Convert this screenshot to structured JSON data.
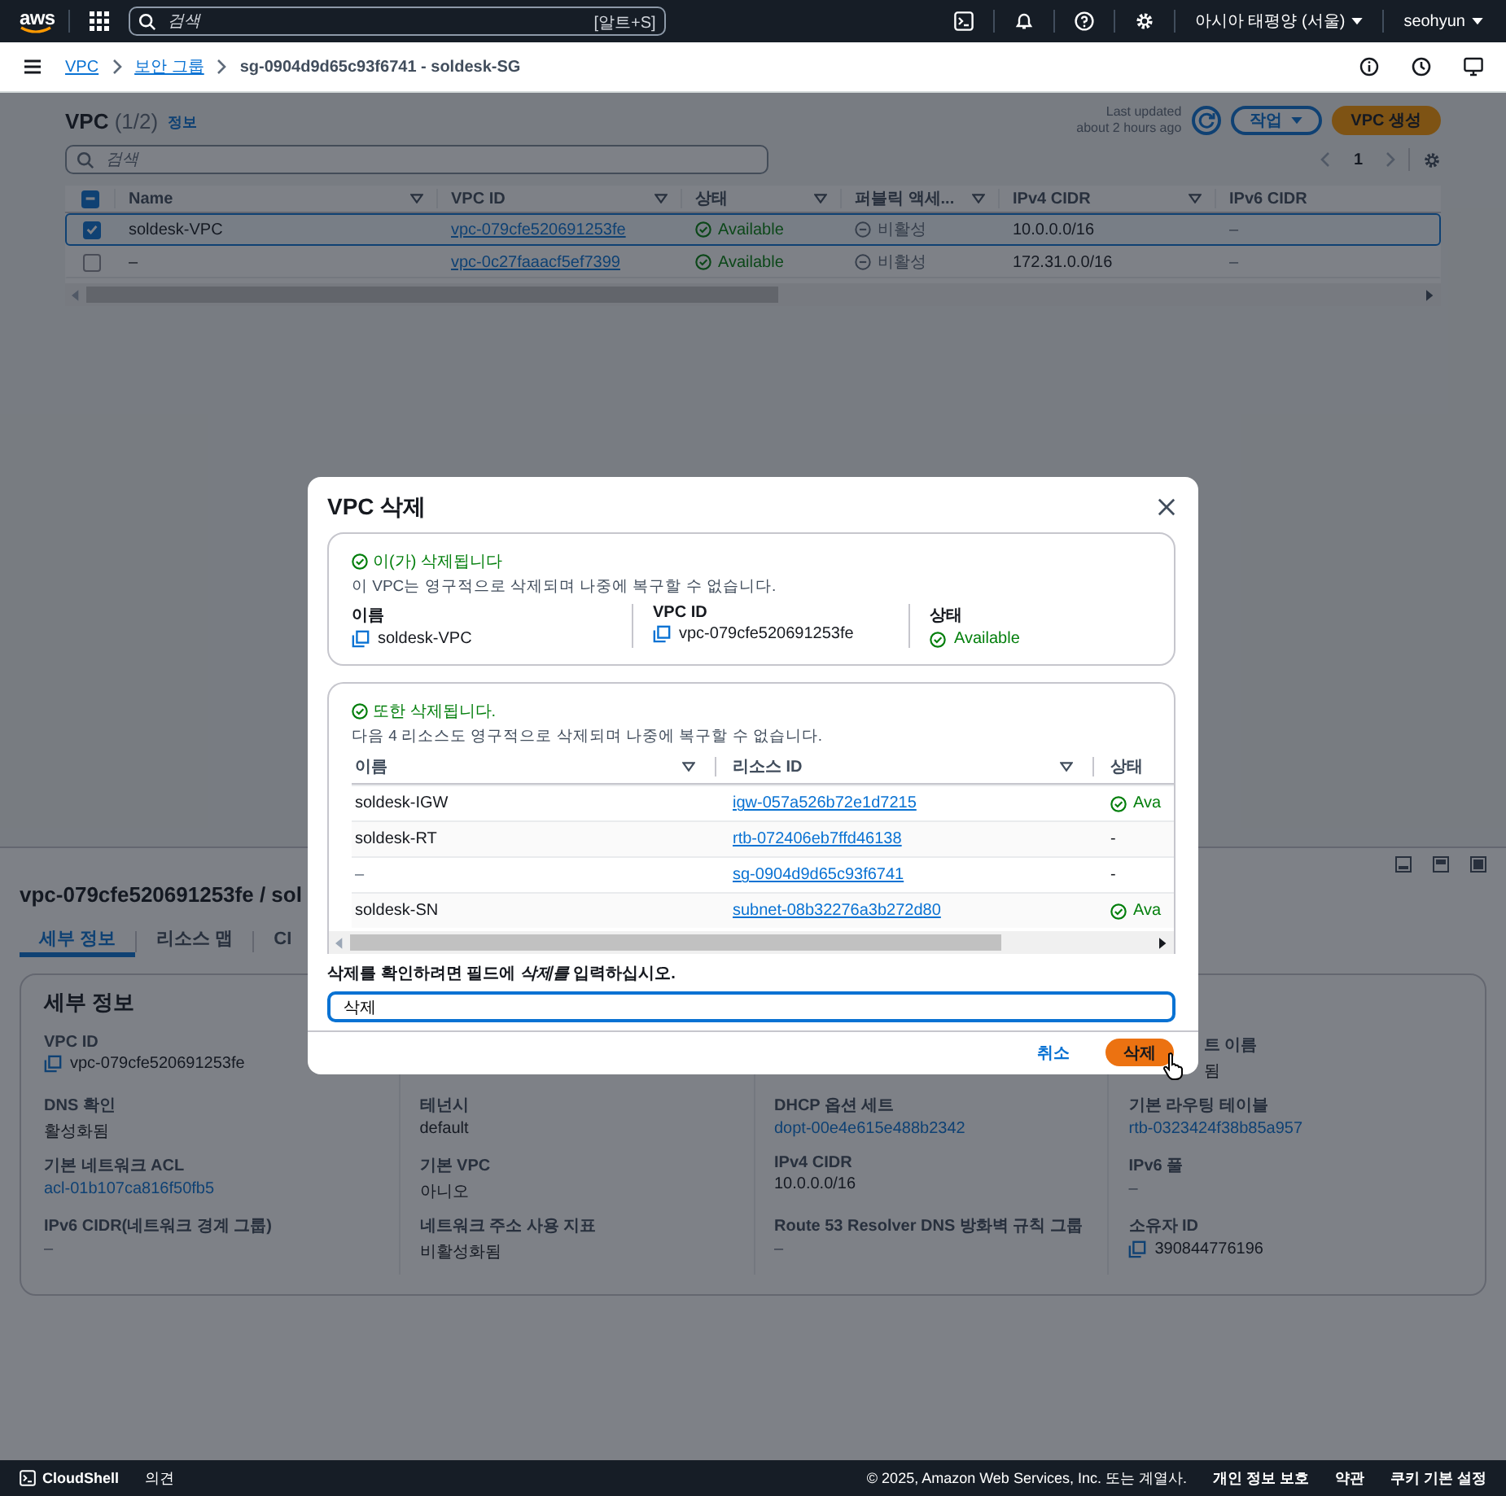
{
  "top_nav": {
    "logo": "aws",
    "search_placeholder": "검색",
    "shortcut": "[알트+S]",
    "region": "아시아 태평양 (서울)",
    "user": "seohyun"
  },
  "breadcrumbs": [
    {
      "label": "VPC",
      "link": true
    },
    {
      "label": "보안 그룹",
      "link": true
    },
    {
      "label": "sg-0904d9d65c93f6741 - soldesk-SG",
      "link": false
    }
  ],
  "vpc_list": {
    "title": "VPC",
    "count": "(1/2)",
    "info": "정보",
    "last_updated": "Last updated",
    "last_updated_time": "about 2 hours ago",
    "actions_button": "작업",
    "create_button": "VPC 생성",
    "search_placeholder": "검색",
    "page": "1",
    "select_all_indeterminate": true,
    "columns": [
      "Name",
      "VPC ID",
      "상태",
      "퍼블릭 액세...",
      "IPv4 CIDR",
      "IPv6 CIDR"
    ],
    "rows": [
      {
        "selected": true,
        "name": "soldesk-VPC",
        "vpc_id": "vpc-079cfe520691253fe",
        "state": "Available",
        "public_access": "비활성",
        "ipv4": "10.0.0.0/16",
        "ipv6": "–"
      },
      {
        "selected": false,
        "name": "–",
        "vpc_id": "vpc-0c27faaacf5ef7399",
        "state": "Available",
        "public_access": "비활성",
        "ipv4": "172.31.0.0/16",
        "ipv6": "–"
      }
    ]
  },
  "split_panel": {
    "title": "vpc-079cfe520691253fe / sol",
    "tabs": [
      {
        "label": "세부 정보",
        "selected": true
      },
      {
        "label": "리소스 맵",
        "selected": false
      },
      {
        "label": "CI",
        "selected": false
      }
    ],
    "details_title": "세부 정보",
    "columns": [
      [
        {
          "label": "VPC ID",
          "value": "vpc-079cfe520691253fe",
          "kind": "copy"
        },
        {
          "label": "DNS 확인",
          "value": "활성화됨",
          "kind": "text"
        },
        {
          "label": "기본 네트워크 ACL",
          "value": "acl-01b107ca816f50fb5",
          "kind": "link"
        },
        {
          "label": "IPv6 CIDR(네트워크 경계 그룹)",
          "value": "–",
          "kind": "text"
        }
      ],
      [
        null,
        {
          "label": "테넌시",
          "value": "default",
          "kind": "text"
        },
        {
          "label": "기본 VPC",
          "value": "아니오",
          "kind": "text"
        },
        {
          "label": "네트워크 주소 사용 지표",
          "value": "비활성화됨",
          "kind": "text"
        }
      ],
      [
        null,
        {
          "label": "DHCP 옵션 세트",
          "value": "dopt-00e4e615e488b2342",
          "kind": "link"
        },
        {
          "label": "IPv4 CIDR",
          "value": "10.0.0.0/16",
          "kind": "text"
        },
        {
          "label": "Route 53 Resolver DNS 방화벽 규칙 그룹",
          "value": "–",
          "kind": "text"
        }
      ],
      [
        {
          "label": "트 이름",
          "value": "됨",
          "kind": "text",
          "clipped": true
        },
        {
          "label": "기본 라우팅 테이블",
          "value": "rtb-0323424f38b85a957",
          "kind": "link"
        },
        {
          "label": "IPv6 풀",
          "value": "–",
          "kind": "text"
        },
        {
          "label": "소유자 ID",
          "value": "390844776196",
          "kind": "copy"
        }
      ]
    ]
  },
  "modal": {
    "title": "VPC 삭제",
    "vpc_box": {
      "status": "이(가) 삭제됩니다",
      "description": "이 VPC는 영구적으로 삭제되며 나중에 복구할 수 없습니다.",
      "fields": [
        {
          "label": "이름",
          "value": "soldesk-VPC",
          "kind": "copy"
        },
        {
          "label": "VPC ID",
          "value": "vpc-079cfe520691253fe",
          "kind": "copy"
        },
        {
          "label": "상태",
          "value": "Available",
          "kind": "status"
        }
      ]
    },
    "resources_box": {
      "status": "또한 삭제됩니다.",
      "description": "다음 4 리소스도 영구적으로 삭제되며 나중에 복구할 수 없습니다.",
      "columns": [
        "이름",
        "리소스 ID",
        "상태"
      ],
      "rows": [
        {
          "name": "soldesk-IGW",
          "resource_id": "igw-057a526b72e1d7215",
          "state": "Ava",
          "kind": "available"
        },
        {
          "name": "soldesk-RT",
          "resource_id": "rtb-072406eb7ffd46138",
          "state": "-",
          "kind": "none"
        },
        {
          "name": "–",
          "resource_id": "sg-0904d9d65c93f6741",
          "state": "-",
          "kind": "none"
        },
        {
          "name": "soldesk-SN",
          "resource_id": "subnet-08b32276a3b272d80",
          "state": "Ava",
          "kind": "available"
        }
      ]
    },
    "confirm_label": "삭제를 확인하려면 필드에 *삭제를* 입력하십시오.",
    "confirm_value": "삭제",
    "cancel_button": "취소",
    "delete_button": "삭제"
  },
  "footer": {
    "cloudshell": "CloudShell",
    "feedback": "의견",
    "copyright": "© 2025, Amazon Web Services, Inc. 또는 계열사.",
    "links": [
      "개인 정보 보호",
      "약관",
      "쿠키 기본 설정"
    ]
  }
}
